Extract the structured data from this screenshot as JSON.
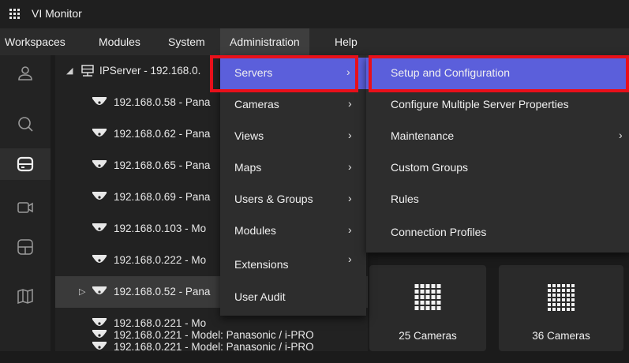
{
  "app": {
    "title": "VI Monitor"
  },
  "menubar": [
    "Workspaces",
    "Modules",
    "System",
    "Administration",
    "Help"
  ],
  "tree": {
    "server": "IPServer - 192.168.0.",
    "rows": [
      "192.168.0.58 - Pana",
      "192.168.0.62 - Pana",
      "192.168.0.65 - Pana",
      "192.168.0.69 - Pana",
      "192.168.0.103 - Mo",
      "192.168.0.222 - Mo",
      "192.168.0.52 - Pana",
      "192.168.0.221 - Mo",
      "192.168.0.221 - Model: Panasonic / i-PRO",
      "192.168.0.221 - Model: Panasonic / i-PRO"
    ]
  },
  "admin_menu": [
    "Servers",
    "Cameras",
    "Views",
    "Maps",
    "Users & Groups",
    "Modules",
    "Extensions",
    "User Audit"
  ],
  "servers_submenu": [
    "Setup and Configuration",
    "Configure Multiple Server Properties",
    "Maintenance",
    "Custom Groups",
    "Rules",
    "Connection Profiles"
  ],
  "tiles": [
    "25 Cameras",
    "36 Cameras"
  ],
  "colors": {
    "highlight": "#5b5fdb",
    "annotation": "#e8101a",
    "background": "#1b1b1b"
  },
  "icons": [
    "user-icon",
    "search-icon",
    "server-icon",
    "camera-icon",
    "layout-icon",
    "map-icon"
  ]
}
